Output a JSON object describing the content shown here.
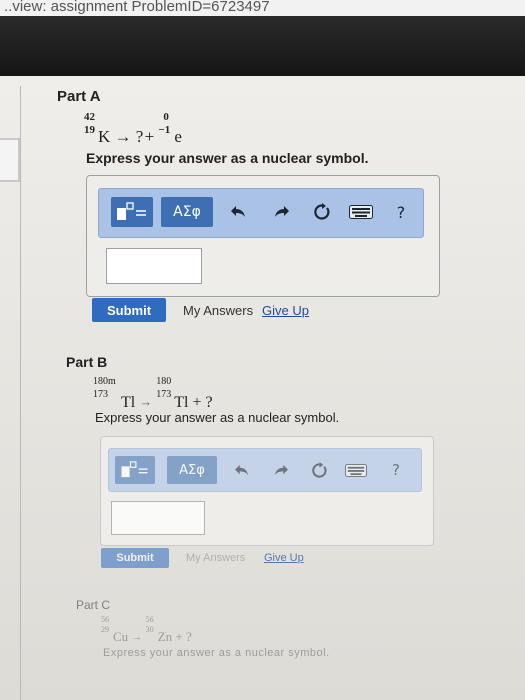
{
  "header": {
    "title": "..view: assignment ProblemID=6723497"
  },
  "partA": {
    "title": "Part A",
    "equation": {
      "reactant": {
        "mass": "42",
        "atomic": "19",
        "symbol": "K"
      },
      "arrow": "→",
      "unknown": "?",
      "plus": "+",
      "product": {
        "mass": "0",
        "atomic": "−1",
        "symbol": "e"
      }
    },
    "prompt": "Express your answer as a nuclear symbol.",
    "toolbar": {
      "greek_label": "ΑΣφ",
      "help_label": "?"
    },
    "answer_value": "",
    "submit_label": "Submit",
    "my_answers_label": "My Answers",
    "give_up_label": "Give Up"
  },
  "partB": {
    "title": "Part B",
    "equation": {
      "reactant": {
        "mass": "180m",
        "atomic": "173",
        "symbol": "Tl"
      },
      "arrow": "→",
      "product": {
        "mass": "180",
        "atomic": "173",
        "symbol": "Tl"
      },
      "plus": "+",
      "unknown": "?"
    },
    "prompt": "Express your answer as a nuclear symbol.",
    "toolbar": {
      "greek_label": "ΑΣφ",
      "help_label": "?"
    },
    "answer_value": "",
    "submit_label": "Submit",
    "my_answers_label": "My Answers",
    "give_up_label": "Give Up"
  },
  "partC": {
    "title": "Part C",
    "equation": {
      "reactant": {
        "mass": "56",
        "atomic": "29",
        "symbol": "Cu"
      },
      "arrow": "→",
      "product": {
        "mass": "56",
        "atomic": "30",
        "symbol": "Zn"
      },
      "plus": "+",
      "unknown": "?"
    },
    "prompt": "Express your answer as a nuclear symbol."
  }
}
